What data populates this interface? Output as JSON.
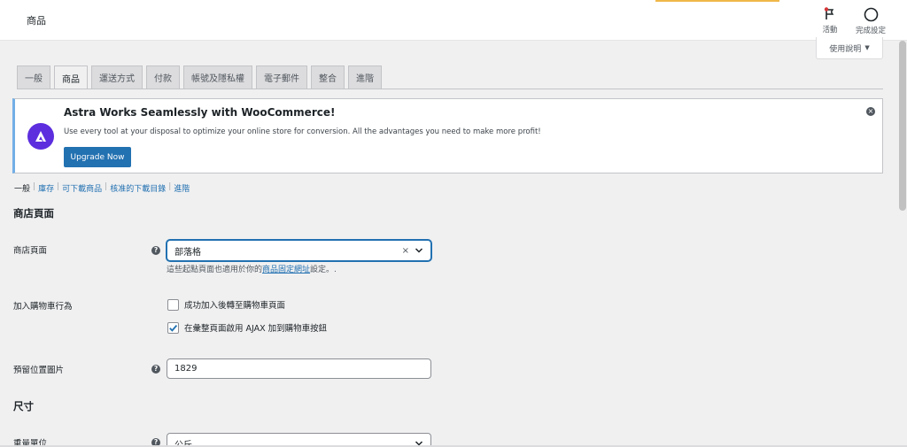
{
  "header": {
    "page_title": "商品",
    "activity_label": "活動",
    "setup_label": "完成設定",
    "help_label": "使用說明"
  },
  "tabs": [
    {
      "label": "一般",
      "active": false
    },
    {
      "label": "商品",
      "active": true
    },
    {
      "label": "運送方式",
      "active": false
    },
    {
      "label": "付款",
      "active": false
    },
    {
      "label": "帳號及隱私權",
      "active": false
    },
    {
      "label": "電子郵件",
      "active": false
    },
    {
      "label": "整合",
      "active": false
    },
    {
      "label": "進階",
      "active": false
    }
  ],
  "notice": {
    "title": "Astra Works Seamlessly with WooCommerce!",
    "text": "Use every tool at your disposal to optimize your online store for conversion. All the advantages you need to make more profit!",
    "button": "Upgrade Now",
    "logo_color": "#5c2ede"
  },
  "subsub": {
    "current": "一般",
    "links": [
      "庫存",
      "可下載商品",
      "核准的下載目錄",
      "進階"
    ],
    "separator": "|"
  },
  "sections": {
    "shop_pages": "商店頁面",
    "dimensions": "尺寸"
  },
  "fields": {
    "shop_page": {
      "label": "商店頁面",
      "value": "部落格",
      "clear": "×",
      "desc_prefix": "這些起點頁面也適用於你的",
      "desc_link": "商品固定網址",
      "desc_suffix": "設定。."
    },
    "add_to_cart": {
      "label": "加入購物車行為",
      "option1": {
        "label": "成功加入後轉至購物車頁面",
        "checked": false
      },
      "option2": {
        "label": "在彙整頁面啟用 AJAX 加到購物車按鈕",
        "checked": true
      }
    },
    "placeholder_image": {
      "label": "預留位置圖片",
      "value": "1829"
    },
    "weight_unit": {
      "label": "重量單位",
      "value": "公斤"
    }
  },
  "colors": {
    "accent": "#2271b1",
    "notice_border": "#72aee6",
    "background": "#f0f0f1"
  }
}
